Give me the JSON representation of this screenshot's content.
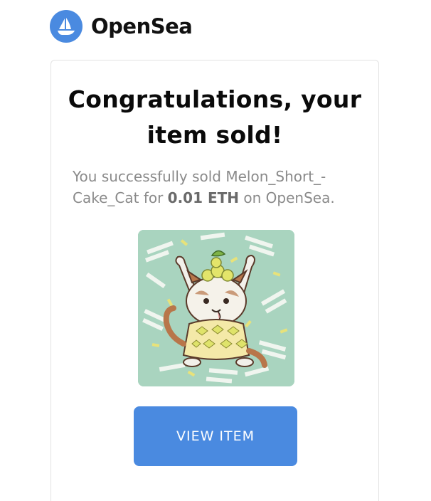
{
  "header": {
    "brand_name": "OpenSea",
    "logo_icon": "opensea-ship-icon"
  },
  "email": {
    "headline": "Congratulations, your item sold!",
    "message_prefix": "You successfully sold Melon_Short_-Cake_Cat for ",
    "price": "0.01 ETH",
    "message_suffix": " on OpenSea.",
    "item_image_icon": "cat-illustration-image",
    "button_label": "VIEW ITEM"
  },
  "colors": {
    "accent": "#4a8ae0",
    "headline": "#0a0a0a",
    "body_text": "#8a8a8a",
    "image_background": "#a9d4bf"
  }
}
